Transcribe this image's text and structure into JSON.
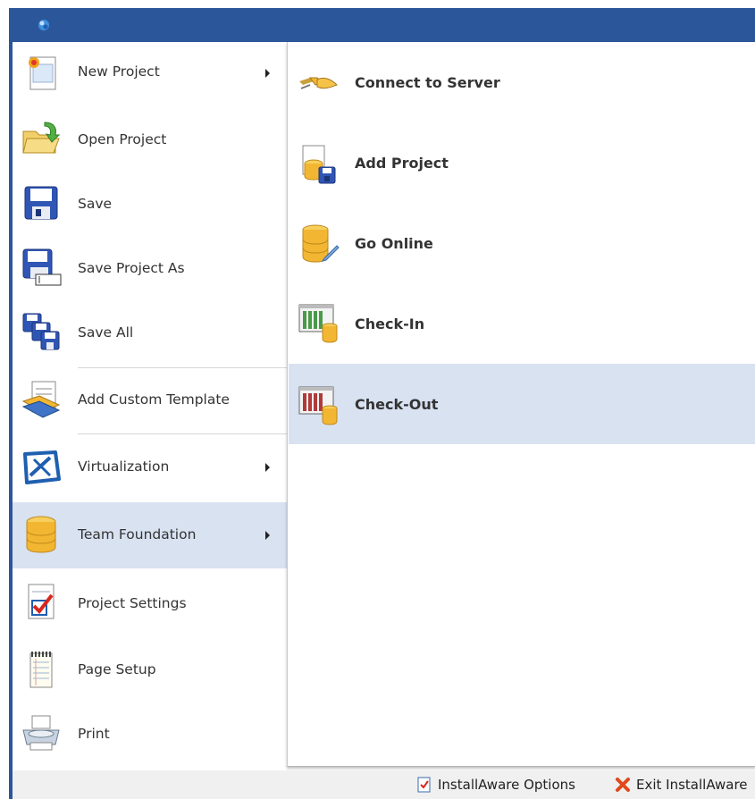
{
  "window": {
    "app_icon": "installaware-orb-icon"
  },
  "menu": {
    "items": [
      {
        "label": "New Project",
        "icon": "new-project-icon",
        "submenu": true
      },
      {
        "label": "Open Project",
        "icon": "open-folder-icon",
        "submenu": false
      },
      {
        "label": "Save",
        "icon": "floppy-disk-icon",
        "submenu": false
      },
      {
        "label": "Save Project As",
        "icon": "save-as-icon",
        "submenu": false
      },
      {
        "label": "Save All",
        "icon": "save-all-icon",
        "submenu": false
      },
      {
        "label": "Add Custom Template",
        "icon": "template-icon",
        "submenu": false
      },
      {
        "label": "Virtualization",
        "icon": "virtualization-icon",
        "submenu": true
      },
      {
        "label": "Team Foundation",
        "icon": "database-icon",
        "submenu": true,
        "selected": true
      },
      {
        "label": "Project Settings",
        "icon": "checklist-icon",
        "submenu": false
      },
      {
        "label": "Page Setup",
        "icon": "notepad-icon",
        "submenu": false
      },
      {
        "label": "Print",
        "icon": "printer-icon",
        "submenu": false
      }
    ]
  },
  "submenu": {
    "items": [
      {
        "label": "Connect to Server",
        "icon": "plug-icon"
      },
      {
        "label": "Add Project",
        "icon": "add-project-icon"
      },
      {
        "label": "Go Online",
        "icon": "go-online-icon"
      },
      {
        "label": "Check-In",
        "icon": "check-in-icon"
      },
      {
        "label": "Check-Out",
        "icon": "check-out-icon",
        "selected": true
      }
    ]
  },
  "footer": {
    "options_label": "InstallAware Options",
    "options_icon": "options-checkbox-icon",
    "exit_label": "Exit InstallAware",
    "exit_icon": "exit-x-icon"
  },
  "colors": {
    "titlebar": "#2b579a",
    "selection": "#d8e2f1",
    "database_gold": "#f2b632"
  }
}
